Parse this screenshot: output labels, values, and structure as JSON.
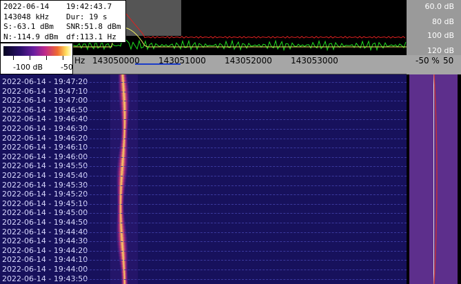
{
  "info": {
    "date": "2022-06-14",
    "time": "19:42:43.7",
    "freq": "143048 kHz",
    "duration": "Dur: 19 s",
    "signal": "S:-63.1 dBm",
    "snr": "SNR:51.8 dBm",
    "noise": "N:-114.9 dBm",
    "df": "df:113.1 Hz"
  },
  "db_scale": [
    "60.0 dB",
    "80 dB",
    "100 dB",
    "120 dB"
  ],
  "colorbar": {
    "min_label": "-100 dB",
    "max_label": "-50"
  },
  "freq_axis": {
    "unit": "Hz",
    "ticks": [
      "143050000",
      "143051000",
      "143052000",
      "143053000"
    ]
  },
  "pct_axis": {
    "left": "-50 %",
    "right": "50"
  },
  "timestamps": [
    "2022-06-14 - 19:47:20",
    "2022-06-14 - 19:47:10",
    "2022-06-14 - 19:47:00",
    "2022-06-14 - 19:46:50",
    "2022-06-14 - 19:46:40",
    "2022-06-14 - 19:46:30",
    "2022-06-14 - 19:46:20",
    "2022-06-14 - 19:46:10",
    "2022-06-14 - 19:46:00",
    "2022-06-14 - 19:45:50",
    "2022-06-14 - 19:45:40",
    "2022-06-14 - 19:45:30",
    "2022-06-14 - 19:45:20",
    "2022-06-14 - 19:45:10",
    "2022-06-14 - 19:45:00",
    "2022-06-14 - 19:44:50",
    "2022-06-14 - 19:44:40",
    "2022-06-14 - 19:44:30",
    "2022-06-14 - 19:44:20",
    "2022-06-14 - 19:44:10",
    "2022-06-14 - 19:44:00",
    "2022-06-14 - 19:43:50"
  ],
  "colors": {
    "waterfall_bg": "#17115c",
    "signal_peak": "#ffd060",
    "spectrum_red": "#e02020",
    "spectrum_green": "#20e020",
    "spectrum_yellow": "#f0f060",
    "freq_marker": "#1b3cc8"
  }
}
